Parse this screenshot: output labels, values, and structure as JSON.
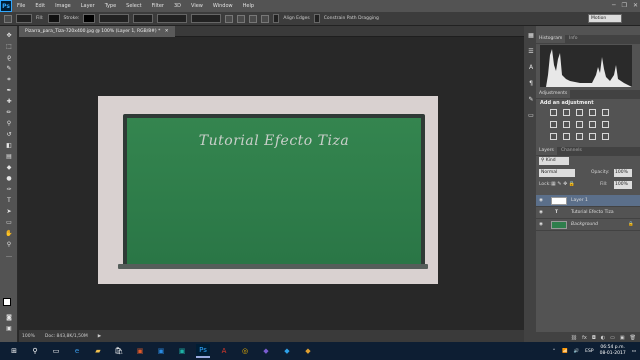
{
  "app": {
    "logo": "Ps"
  },
  "menu": [
    "File",
    "Edit",
    "Image",
    "Layer",
    "Type",
    "Select",
    "Filter",
    "3D",
    "View",
    "Window",
    "Help"
  ],
  "window_controls": [
    "─",
    "❐",
    "✕"
  ],
  "options_bar": {
    "fill_label": "Fill:",
    "stroke_label": "Stroke:",
    "align_edges": "Align Edges",
    "constrain": "Constrain Path Dragging",
    "workspace": "Motion"
  },
  "document": {
    "tab_label": "Pizarra_para_Tiza-720x400.jpg @ 100% (Layer 1, RGB/8#) *",
    "close": "✕"
  },
  "canvas": {
    "chalk_text": "Tutorial Efecto Tiza"
  },
  "status": {
    "zoom": "100%",
    "doc": "Doc: 843,8K/1,50M"
  },
  "panels": {
    "histogram_tab": "Histogram",
    "info_tab": "Info",
    "adjustments_tab": "Adjustments",
    "add_adjustment": "Add an adjustment",
    "layers_tab": "Layers",
    "channels_tab": "Channels",
    "kind": "Kind",
    "blend_mode": "Normal",
    "opacity_label": "Opacity:",
    "opacity_value": "100%",
    "lock_label": "Lock:",
    "fill_label": "Fill:",
    "fill_value": "100%",
    "layers": [
      {
        "name": "Layer 1",
        "type": "pixel"
      },
      {
        "name": "Tutorial Efecto Tiza",
        "type": "text"
      },
      {
        "name": "Background",
        "type": "background"
      }
    ]
  },
  "taskbar": {
    "time": "06:54 p.m.",
    "date": "08-01-2017",
    "lang": "ESP"
  },
  "colors": {
    "accent": "#31a8ff",
    "board": "#2f7e4c",
    "selected_layer": "#5b6f8a"
  }
}
